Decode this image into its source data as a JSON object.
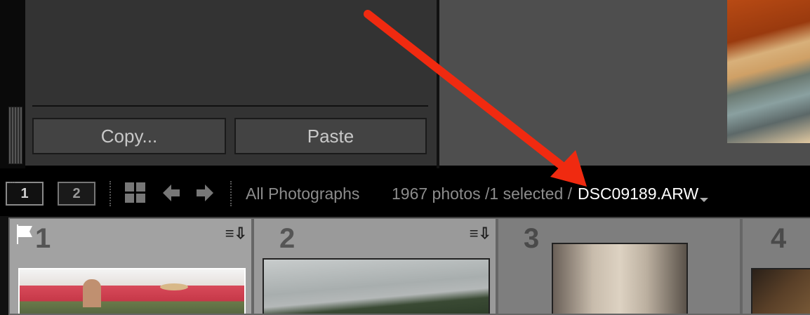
{
  "panel": {
    "copy_label": "Copy...",
    "paste_label": "Paste"
  },
  "filmstrip_bar": {
    "monitor1": "1",
    "monitor2": "2",
    "source": "All Photographs",
    "count_text": "1967 photos /1 selected /",
    "filename": "DSC09189.ARW"
  },
  "filmstrip": {
    "cells": [
      {
        "number": "1",
        "flagged": true,
        "badge": "≡⇩"
      },
      {
        "number": "2",
        "flagged": false,
        "badge": "≡⇩"
      },
      {
        "number": "3",
        "flagged": false,
        "badge": ""
      },
      {
        "number": "4",
        "flagged": false,
        "badge": ""
      }
    ]
  },
  "annotation": {
    "arrow_color": "#f02a10"
  }
}
